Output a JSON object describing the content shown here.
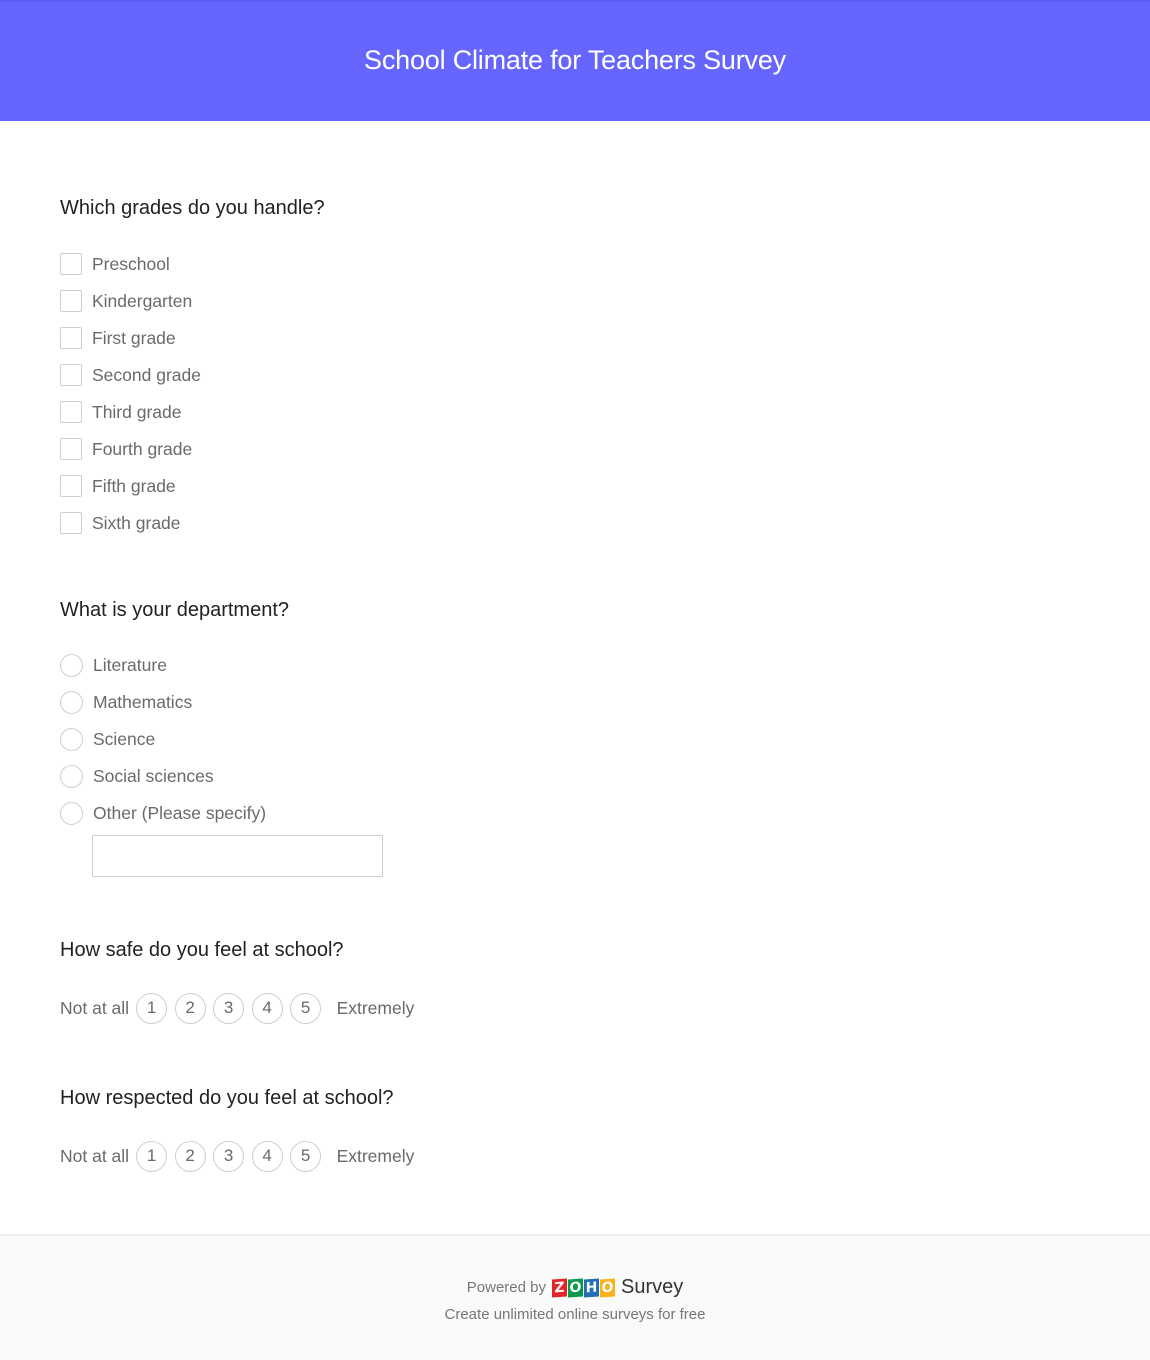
{
  "header": {
    "title": "School Climate for Teachers Survey",
    "background_color": "#6666ff"
  },
  "questions": [
    {
      "text": "Which grades do you handle?",
      "type": "checkbox",
      "options": [
        "Preschool",
        "Kindergarten",
        "First grade",
        "Second grade",
        "Third grade",
        "Fourth grade",
        "Fifth grade",
        "Sixth grade"
      ]
    },
    {
      "text": "What is your department?",
      "type": "radio",
      "options": [
        "Literature",
        "Mathematics",
        "Science",
        "Social sciences",
        "Other (Please specify)"
      ],
      "other_input_value": "",
      "other_input_placeholder": ""
    },
    {
      "text": "How safe do you feel at school?",
      "type": "rating",
      "min_label": "Not at all",
      "max_label": "Extremely",
      "values": [
        "1",
        "2",
        "3",
        "4",
        "5"
      ]
    },
    {
      "text": "How respected do you feel at school?",
      "type": "rating",
      "min_label": "Not at all",
      "max_label": "Extremely",
      "values": [
        "1",
        "2",
        "3",
        "4",
        "5"
      ]
    }
  ],
  "footer": {
    "powered_by": "Powered by",
    "brand_letters": [
      "Z",
      "O",
      "H",
      "O"
    ],
    "brand_product": "Survey",
    "tagline": "Create unlimited online surveys for free"
  }
}
